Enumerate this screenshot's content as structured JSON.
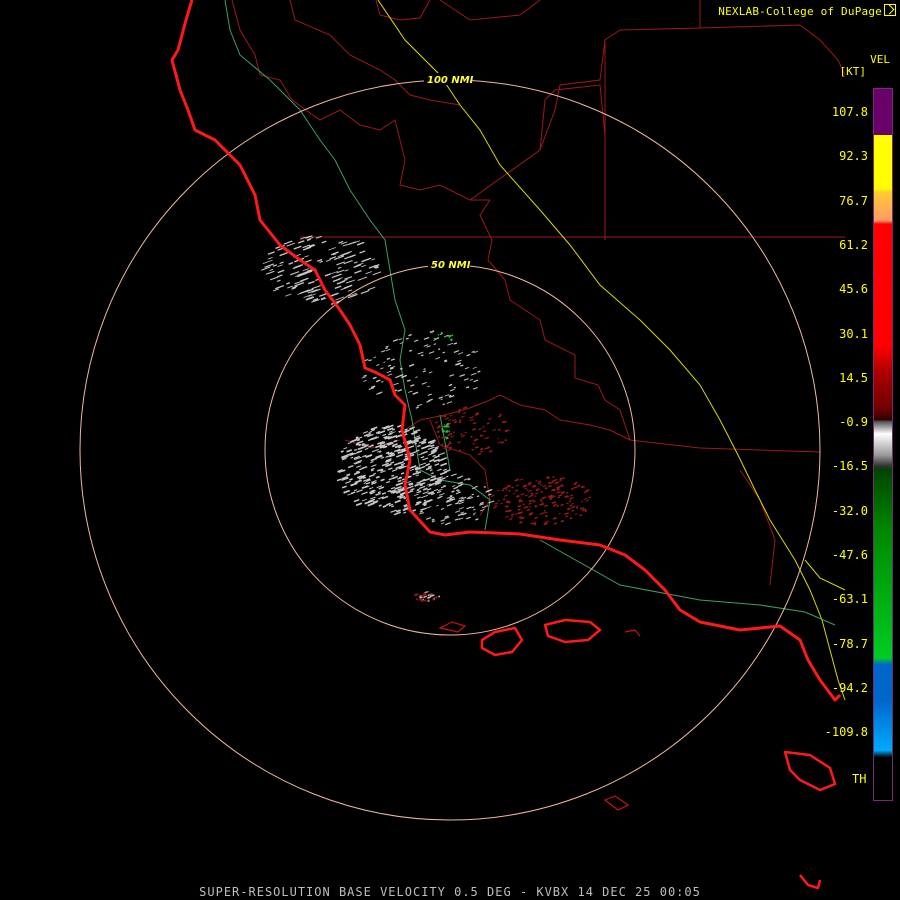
{
  "credit": "NEXLAB-College of DuPage",
  "legend": {
    "title": "VEL",
    "units": "[KT]",
    "ticks": [
      "107.8",
      "92.3",
      "76.7",
      "61.2",
      "45.6",
      "30.1",
      "14.5",
      "-0.9",
      "-16.5",
      "-32.0",
      "-47.6",
      "-63.1",
      "-78.7",
      "-94.2",
      "-109.8"
    ],
    "th_label": "TH",
    "colors": {
      "purple": "#6a006a",
      "yellow": "#ffff00",
      "salmon": "#ff9966",
      "red": "#ff0000",
      "darkred": "#700000",
      "gray": "#9a9a9a",
      "green": "#00cc22",
      "blue": "#0066cc",
      "cyan": "#00aaff",
      "black": "#000000"
    }
  },
  "rings": {
    "outer_label": "100 NMI",
    "inner_label": "50 NMI"
  },
  "footer": "SUPER-RESOLUTION BASE VELOCITY 0.5 DEG - KVBX 14 DEC 25 00:05"
}
